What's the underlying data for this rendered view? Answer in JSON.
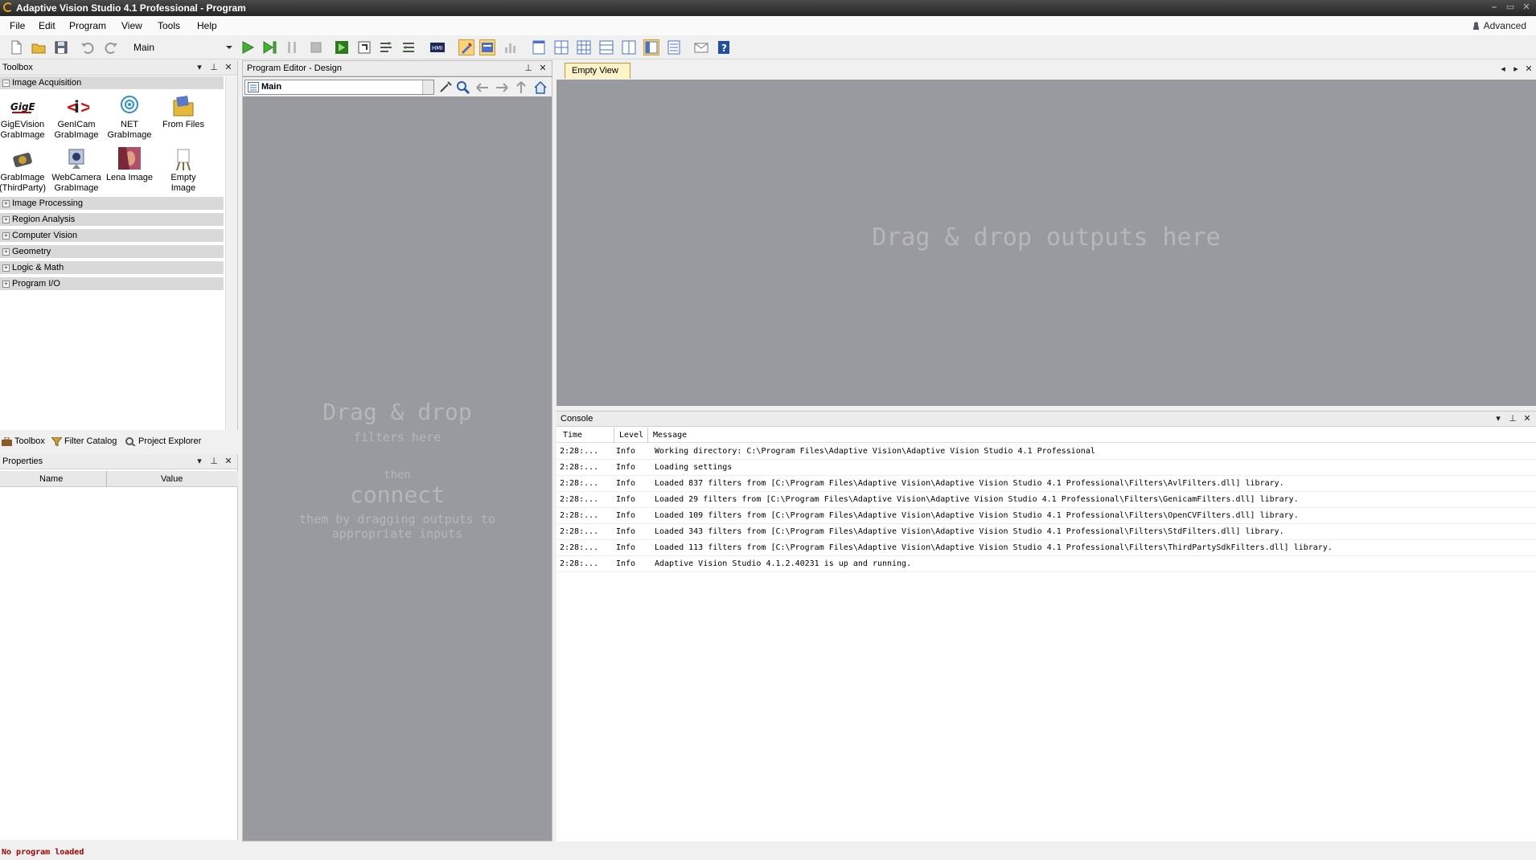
{
  "window": {
    "title": "Adaptive Vision Studio 4.1 Professional - Program"
  },
  "menu": {
    "items": [
      "File",
      "Edit",
      "Program",
      "View",
      "Tools",
      "Help"
    ],
    "mode_label": "Advanced"
  },
  "toolbar": {
    "macro_selected": "Main"
  },
  "toolbox": {
    "title": "Toolbox",
    "category_open": "Image Acquisition",
    "tools": [
      {
        "label1": "GigEVision",
        "label2": "GrabImage",
        "icon": "gige-icon"
      },
      {
        "label1": "GenICam",
        "label2": "GrabImage",
        "icon": "genicam-icon"
      },
      {
        "label1": "NET",
        "label2": "GrabImage",
        "icon": "net-icon"
      },
      {
        "label1": "From Files",
        "label2": "",
        "icon": "folder-icon"
      },
      {
        "label1": "GrabImage",
        "label2": "(ThirdParty)",
        "icon": "camera-icon"
      },
      {
        "label1": "WebCamera",
        "label2": "GrabImage",
        "icon": "webcam-icon"
      },
      {
        "label1": "Lena Image",
        "label2": "",
        "icon": "lena-icon"
      },
      {
        "label1": "Empty",
        "label2": "Image",
        "icon": "easel-icon"
      }
    ],
    "categories": [
      "Image Processing",
      "Region Analysis",
      "Computer Vision",
      "Geometry",
      "Logic & Math",
      "Program I/O"
    ]
  },
  "bottom_tabs": [
    "Toolbox",
    "Filter Catalog",
    "Project Explorer"
  ],
  "properties": {
    "title": "Properties",
    "col_name": "Name",
    "col_value": "Value"
  },
  "program_editor": {
    "title": "Program Editor - Design",
    "macro": "Main",
    "hint": {
      "line1": "Drag & drop",
      "line2": "filters here",
      "line3": "then",
      "line4": "connect",
      "line5": "them by dragging outputs to",
      "line6": "appropriate inputs"
    }
  },
  "view": {
    "tab": "Empty View",
    "hint": "Drag & drop outputs here"
  },
  "console": {
    "title": "Console",
    "columns": {
      "time": "Time",
      "level": "Level",
      "message": "Message"
    },
    "rows": [
      {
        "time": "2:28:...",
        "level": "Info",
        "message": "Working directory: C:\\Program Files\\Adaptive Vision\\Adaptive Vision Studio 4.1 Professional"
      },
      {
        "time": "2:28:...",
        "level": "Info",
        "message": "Loading settings"
      },
      {
        "time": "2:28:...",
        "level": "Info",
        "message": "Loaded 837 filters from [C:\\Program Files\\Adaptive Vision\\Adaptive Vision Studio 4.1 Professional\\Filters\\AvlFilters.dll] library."
      },
      {
        "time": "2:28:...",
        "level": "Info",
        "message": "Loaded 29 filters from [C:\\Program Files\\Adaptive Vision\\Adaptive Vision Studio 4.1 Professional\\Filters\\GenicamFilters.dll] library."
      },
      {
        "time": "2:28:...",
        "level": "Info",
        "message": "Loaded 109 filters from [C:\\Program Files\\Adaptive Vision\\Adaptive Vision Studio 4.1 Professional\\Filters\\OpenCVFilters.dll] library."
      },
      {
        "time": "2:28:...",
        "level": "Info",
        "message": "Loaded 343 filters from [C:\\Program Files\\Adaptive Vision\\Adaptive Vision Studio 4.1 Professional\\Filters\\StdFilters.dll] library."
      },
      {
        "time": "2:28:...",
        "level": "Info",
        "message": "Loaded 113 filters from [C:\\Program Files\\Adaptive Vision\\Adaptive Vision Studio 4.1 Professional\\Filters\\ThirdPartySdkFilters.dll] library."
      },
      {
        "time": "2:28:...",
        "level": "Info",
        "message": "Adaptive Vision Studio 4.1.2.40231 is up and running."
      }
    ]
  },
  "status": {
    "text": "No program loaded"
  }
}
